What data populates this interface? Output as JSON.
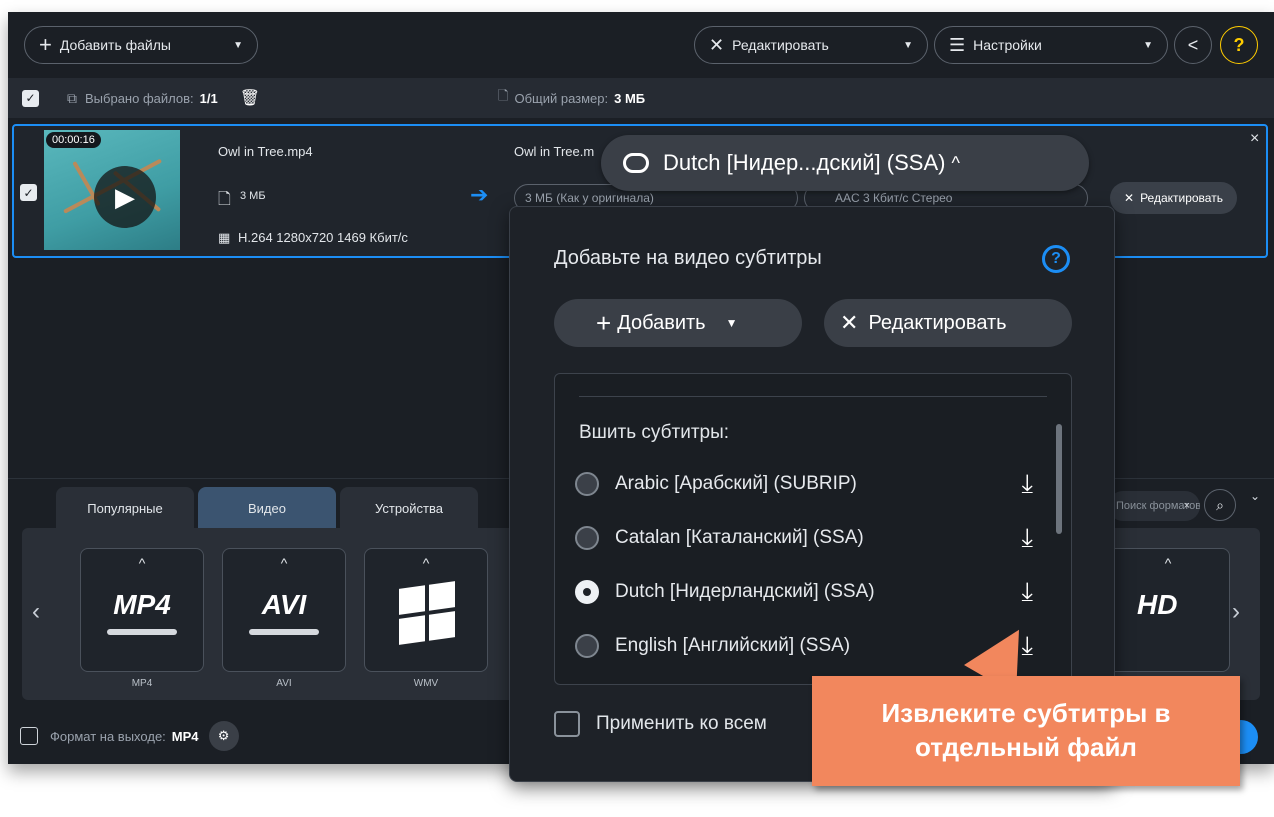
{
  "toolbar": {
    "add_files": "Добавить файлы",
    "edit": "Редактировать",
    "settings": "Настройки",
    "help": "?"
  },
  "selection": {
    "selected_label": "Выбрано файлов:",
    "selected_value": "1/1",
    "total_size_label": "Общий размер:",
    "total_size_value": "3 МБ"
  },
  "file": {
    "duration": "00:00:16",
    "name": "Owl in Tree.mp4",
    "size": "3 МБ",
    "codec": "H.264 1280x720 1469 Кбит/с",
    "output_name": "Owl in Tree.m",
    "output_size": "3 МБ (Как у оригинала)",
    "audio": "AAC 3 Кбит/с Стерео",
    "edit": "Редактировать",
    "close": "×"
  },
  "subtitle_dropdown": {
    "current": "Dutch [Нидер...дский] (SSA)",
    "panel_title": "Добавьте на видео субтитры",
    "add": "Добавить",
    "edit": "Редактировать",
    "section": "Вшить субтитры:",
    "items": [
      {
        "label": "Arabic [Арабский] (SUBRIP)",
        "selected": false
      },
      {
        "label": "Catalan [Каталанский] (SSA)",
        "selected": false
      },
      {
        "label": "Dutch [Нидерландский] (SSA)",
        "selected": true
      },
      {
        "label": "English [Английский] (SSA)",
        "selected": false
      }
    ],
    "apply_all": "Применить ко всем"
  },
  "tabs": [
    "Популярные",
    "Видео",
    "Устройства"
  ],
  "formats": [
    {
      "logo": "MP4",
      "label": "MP4"
    },
    {
      "logo": "AVI",
      "label": "AVI"
    },
    {
      "logo": "",
      "label": "WMV"
    }
  ],
  "search_placeholder": "Поиск форматов и устройств...",
  "footer": {
    "format_label": "Формат на выходе:",
    "format_value": "MP4"
  },
  "callout": {
    "line1": "Извлеките субтитры в",
    "line2": "отдельный файл"
  },
  "colors": {
    "accent": "#1c8ef5",
    "callout": "#f2875d",
    "help": "#ffcc00"
  }
}
